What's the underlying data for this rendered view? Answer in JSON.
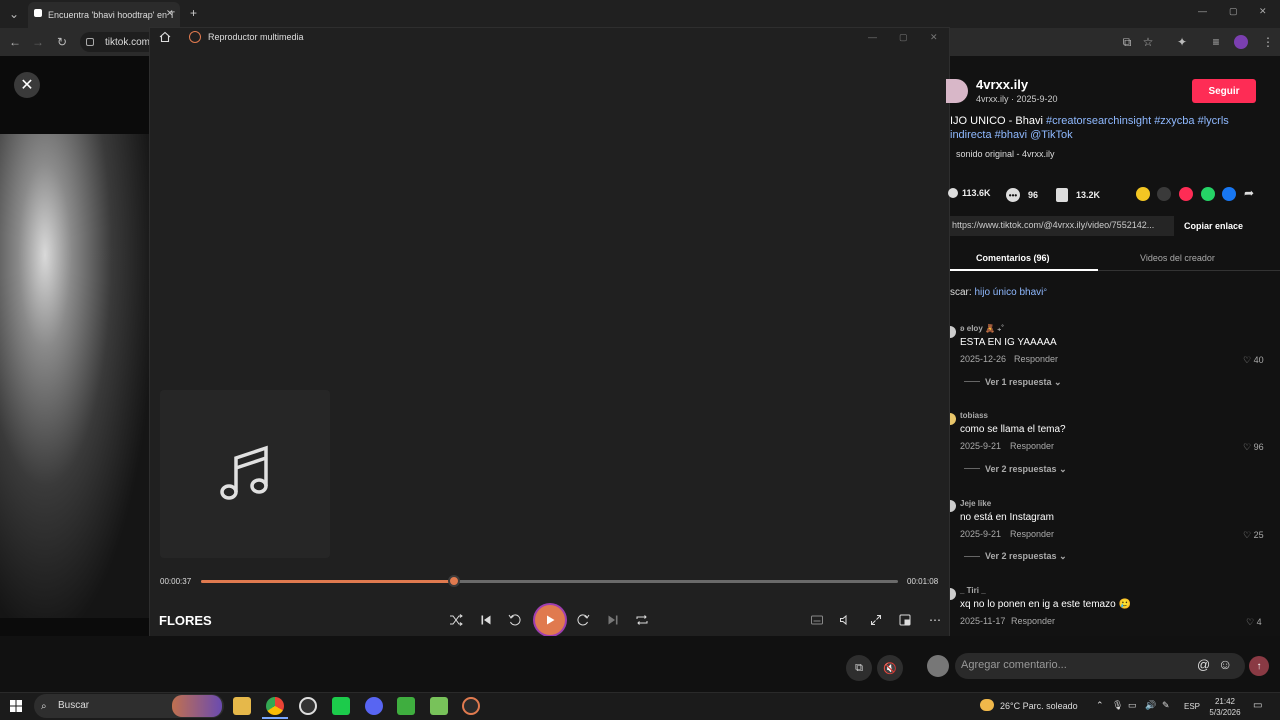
{
  "browser": {
    "tab_title": "Encuentra 'bhavi hoodtrap' en T",
    "tab_close": "✕",
    "new_tab": "+",
    "url": "tiktok.com,",
    "window_controls": [
      "—",
      "▢",
      "✕"
    ]
  },
  "player": {
    "title": "Reproductor multimedia",
    "song_title": "FLORES",
    "time_current": "00:00:37",
    "time_total": "00:01:08",
    "progress_fraction": 0.363,
    "accent_color": "#e07a4f",
    "icons": [
      "home-icon",
      "shuffle-icon",
      "previous-icon",
      "rewind-10-icon",
      "play-icon",
      "forward-30-icon",
      "next-icon",
      "repeat-icon",
      "captions-icon",
      "volume-icon",
      "fullscreen-icon",
      "mini-player-icon",
      "more-icon"
    ]
  },
  "tiktok": {
    "username": "4vrxx.ily",
    "subline": "4vrxx.ily · 2025-9-20",
    "follow_label": "Seguir",
    "follow_color": "#fe2c55",
    "description_plain": "IJO UNICO - Bhavi ",
    "description_tags": "#creatorsearchinsight #zxycba #lycrls",
    "description_line2": "indirecta #bhavi @TikTok",
    "sound": "sonido original - 4vrxx.ily",
    "likes": "113.6K",
    "comments_count": "96",
    "saves": "13.2K",
    "link": "https://www.tiktok.com/@4vrxx.ily/video/7552142...",
    "copy_link": "Copiar enlace",
    "tab_comments": "Comentarios (96)",
    "tab_videos": "Videos del creador",
    "search_prefix": "scar: ",
    "search_term": "hijo único bhavi",
    "search_icon_glyph": "⌕",
    "comments": [
      {
        "user": "ʚ eloy 🧸 ₊˚",
        "text": "ESTA EN IG YAAAAA",
        "date": "2025-12-26",
        "reply": "Responder",
        "likes": "40",
        "replies": "Ver 1 respuesta"
      },
      {
        "user": "tobiass",
        "text": "como se llama el tema?",
        "date": "2025-9-21",
        "reply": "Responder",
        "likes": "96",
        "replies": "Ver 2 respuestas"
      },
      {
        "user": "Jeje like",
        "text": "no está en Instagram",
        "date": "2025-9-21",
        "reply": "Responder",
        "likes": "25",
        "replies": "Ver 2 respuestas"
      },
      {
        "user": "_ Tiri _",
        "text": "xq no lo ponen en ig a este temazo 🥲",
        "date": "2025-11-17",
        "reply": "Responder",
        "likes": "4",
        "replies": ""
      }
    ],
    "comment_placeholder": "Agregar comentario...",
    "mention_glyph": "@",
    "emoji_glyph": "☺",
    "send_glyph": "↑"
  },
  "taskbar": {
    "search": "Buscar",
    "weather": "26°C  Parc. soleado",
    "lang": "ESP",
    "time": "21:42",
    "date": "5/3/2026"
  }
}
